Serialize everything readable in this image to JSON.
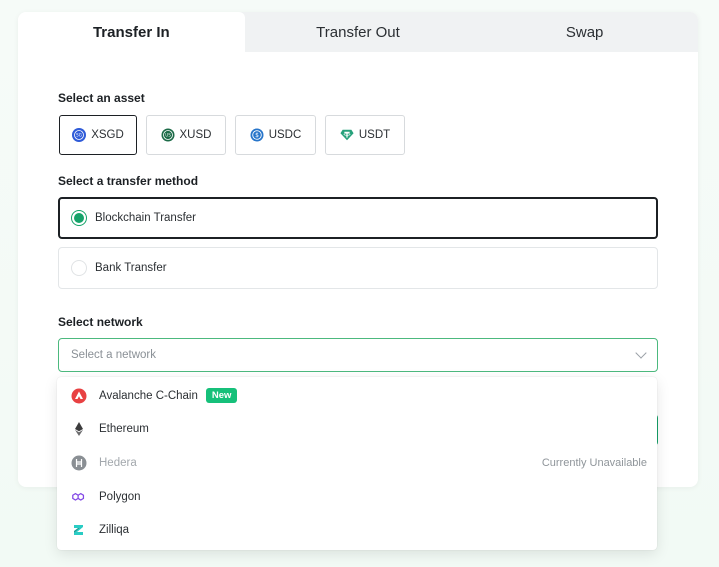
{
  "tabs": [
    {
      "label": "Transfer In",
      "active": true
    },
    {
      "label": "Transfer Out",
      "active": false
    },
    {
      "label": "Swap",
      "active": false
    }
  ],
  "asset_section": {
    "label": "Select an asset",
    "assets": [
      {
        "label": "XSGD",
        "icon": "xsgd-icon",
        "selected": true,
        "color": "#2f5bd8"
      },
      {
        "label": "XUSD",
        "icon": "xusd-icon",
        "selected": false,
        "color": "#1c6b48"
      },
      {
        "label": "USDC",
        "icon": "usdc-icon",
        "selected": false,
        "color": "#2775ca"
      },
      {
        "label": "USDT",
        "icon": "usdt-icon",
        "selected": false,
        "color": "#26a17b"
      }
    ]
  },
  "method_section": {
    "label": "Select a transfer method",
    "methods": [
      {
        "label": "Blockchain Transfer",
        "selected": true
      },
      {
        "label": "Bank Transfer",
        "selected": false
      }
    ]
  },
  "network_section": {
    "label": "Select network",
    "placeholder": "Select a network",
    "options": [
      {
        "label": "Avalanche C-Chain",
        "icon": "avalanche-icon",
        "badge": "New",
        "status": "",
        "disabled": false,
        "color": "#e84142"
      },
      {
        "label": "Ethereum",
        "icon": "ethereum-icon",
        "badge": "",
        "status": "",
        "disabled": false,
        "color": "#3c3c3d"
      },
      {
        "label": "Hedera",
        "icon": "hedera-icon",
        "badge": "",
        "status": "Currently Unavailable",
        "disabled": true,
        "color": "#8a8f94"
      },
      {
        "label": "Polygon",
        "icon": "polygon-icon",
        "badge": "",
        "status": "",
        "disabled": false,
        "color": "#8247e5"
      },
      {
        "label": "Zilliqa",
        "icon": "zilliqa-icon",
        "badge": "",
        "status": "",
        "disabled": false,
        "color": "#29ccc4"
      }
    ]
  },
  "colors": {
    "accent": "#16a36a",
    "badge": "#16c07a"
  }
}
